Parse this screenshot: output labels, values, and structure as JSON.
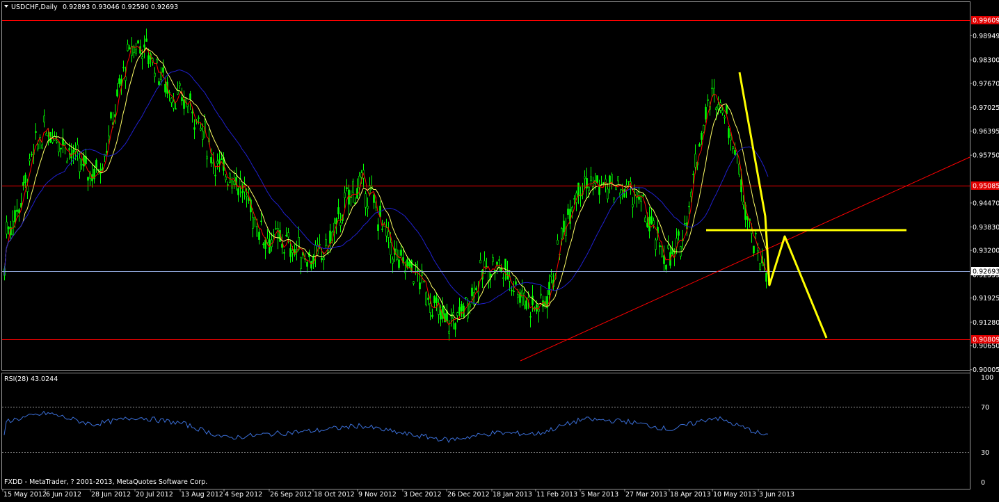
{
  "header": {
    "symbol_label": "USDCHF,Daily",
    "ohlc": "0.92893 0.93046 0.92590 0.92693"
  },
  "price_axis": {
    "labels": [
      "0.98949",
      "0.98300",
      "0.97670",
      "0.97025",
      "0.96395",
      "0.95750",
      "0.94470",
      "0.93830",
      "0.93200",
      "0.92555",
      "0.91925",
      "0.91280",
      "0.90650",
      "0.90005"
    ],
    "hline_labels": [
      "0.99609",
      "0.95085",
      "0.90809"
    ],
    "current_price": "0.92693"
  },
  "time_axis": {
    "labels": [
      "15 May 2012",
      "6 Jun 2012",
      "28 Jun 2012",
      "20 Jul 2012",
      "13 Aug 2012",
      "4 Sep 2012",
      "26 Sep 2012",
      "18 Oct 2012",
      "9 Nov 2012",
      "3 Dec 2012",
      "26 Dec 2012",
      "18 Jan 2013",
      "11 Feb 2013",
      "5 Mar 2013",
      "27 Mar 2013",
      "18 Apr 2013",
      "10 May 2013",
      "3 Jun 2013"
    ]
  },
  "rsi": {
    "label": "RSI(28) 43.0244",
    "axis_labels": [
      "100",
      "70",
      "30",
      "0"
    ]
  },
  "footer": {
    "copyright": "FXDD - MetaTrader, ? 2001-2013, MetaQuotes Software Corp."
  },
  "colors": {
    "background": "#000000",
    "bull_candle": "#00ff00",
    "hline": "#ff0000",
    "fast_ma": "#ff0000",
    "mid_ma": "#ffff66",
    "slow_ma": "#2020d0",
    "projection": "#ffff00",
    "rsi_line": "#3b6fd8",
    "current_price_line": "#8aa0d0"
  },
  "chart_data": {
    "type": "line",
    "title": "USDCHF,Daily",
    "ylim": [
      0.9,
      0.9985
    ],
    "horizontal_levels": [
      0.99609,
      0.95085,
      0.90809
    ],
    "current_price": 0.92693,
    "trendline_points": [
      {
        "x": "18 Jan 2013",
        "y": 0.902
      },
      {
        "x": "3 Jun 2013",
        "y": 0.936
      }
    ],
    "projection_points": [
      {
        "x": "10 May 2013",
        "y": 0.983
      },
      {
        "x": "3 Jun 2013",
        "y": 0.924
      },
      {
        "x": "3 Jun 2013",
        "y": 0.9375
      },
      {
        "x": "3 Jun 2013",
        "y": 0.908
      }
    ],
    "resistance_line": 0.9385,
    "close_series": [
      {
        "x": "15 May 2012",
        "y": 0.938
      },
      {
        "x": "6 Jun 2012",
        "y": 0.964
      },
      {
        "x": "28 Jun 2012",
        "y": 0.953
      },
      {
        "x": "20 Jul 2012",
        "y": 0.987
      },
      {
        "x": "13 Aug 2012",
        "y": 0.972
      },
      {
        "x": "4 Sep 2012",
        "y": 0.953
      },
      {
        "x": "26 Sep 2012",
        "y": 0.935
      },
      {
        "x": "18 Oct 2012",
        "y": 0.93
      },
      {
        "x": "9 Nov 2012",
        "y": 0.949
      },
      {
        "x": "3 Dec 2012",
        "y": 0.928
      },
      {
        "x": "26 Dec 2012",
        "y": 0.913
      },
      {
        "x": "18 Jan 2013",
        "y": 0.928
      },
      {
        "x": "11 Feb 2013",
        "y": 0.917
      },
      {
        "x": "5 Mar 2013",
        "y": 0.95
      },
      {
        "x": "27 Mar 2013",
        "y": 0.948
      },
      {
        "x": "18 Apr 2013",
        "y": 0.93
      },
      {
        "x": "10 May 2013",
        "y": 0.973
      },
      {
        "x": "3 Jun 2013",
        "y": 0.9269
      }
    ],
    "rsi_series": [
      {
        "x": "15 May 2012",
        "y": 58
      },
      {
        "x": "6 Jun 2012",
        "y": 66
      },
      {
        "x": "28 Jun 2012",
        "y": 55
      },
      {
        "x": "20 Jul 2012",
        "y": 62
      },
      {
        "x": "13 Aug 2012",
        "y": 56
      },
      {
        "x": "4 Sep 2012",
        "y": 42
      },
      {
        "x": "26 Sep 2012",
        "y": 46
      },
      {
        "x": "18 Oct 2012",
        "y": 49
      },
      {
        "x": "9 Nov 2012",
        "y": 54
      },
      {
        "x": "3 Dec 2012",
        "y": 46
      },
      {
        "x": "26 Dec 2012",
        "y": 40
      },
      {
        "x": "18 Jan 2013",
        "y": 47
      },
      {
        "x": "11 Feb 2013",
        "y": 46
      },
      {
        "x": "5 Mar 2013",
        "y": 60
      },
      {
        "x": "27 Mar 2013",
        "y": 58
      },
      {
        "x": "18 Apr 2013",
        "y": 50
      },
      {
        "x": "10 May 2013",
        "y": 62
      },
      {
        "x": "3 Jun 2013",
        "y": 43
      }
    ]
  }
}
